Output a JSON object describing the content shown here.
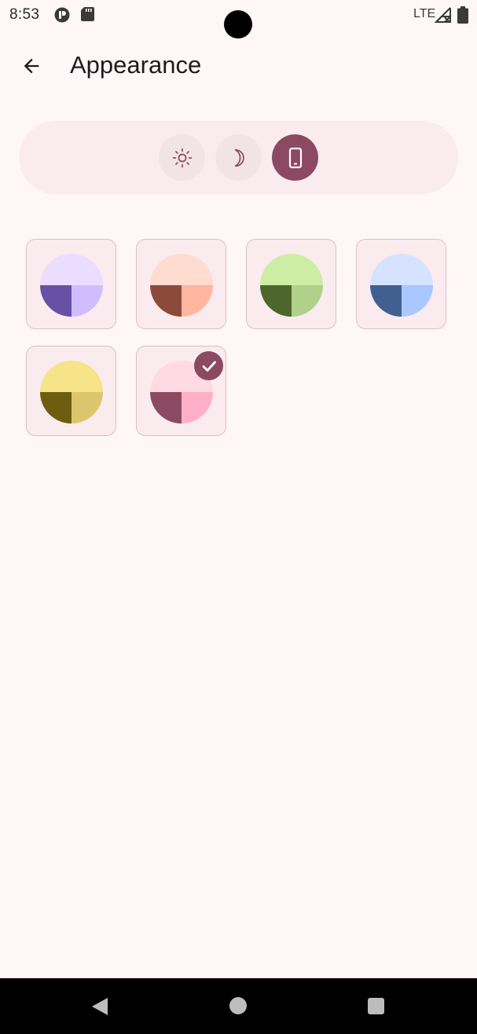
{
  "status_bar": {
    "time": "8:53",
    "network": "LTE",
    "icons": [
      "app-notification-icon",
      "sd-card-icon",
      "signal-no-data-icon",
      "battery-icon"
    ]
  },
  "app_bar": {
    "title": "Appearance",
    "back_icon": "arrow-back-icon"
  },
  "theme_mode": {
    "options": [
      {
        "name": "light",
        "icon": "sun-icon",
        "selected": false
      },
      {
        "name": "dark",
        "icon": "moon-icon",
        "selected": false
      },
      {
        "name": "system",
        "icon": "phone-icon",
        "selected": true
      }
    ],
    "selected_color": "#8B4A62"
  },
  "color_schemes": [
    {
      "name": "purple",
      "top": "#EADDFF",
      "bottom_left": "#6750A4",
      "bottom_right": "#D0BCFF",
      "selected": false
    },
    {
      "name": "orange",
      "top": "#FFDBD0",
      "bottom_left": "#8C4A3A",
      "bottom_right": "#FFB5A0",
      "selected": false
    },
    {
      "name": "green",
      "top": "#CDEDA4",
      "bottom_left": "#4C662B",
      "bottom_right": "#B1D18A",
      "selected": false
    },
    {
      "name": "blue",
      "top": "#D6E3FF",
      "bottom_left": "#415F91",
      "bottom_right": "#AAC7FF",
      "selected": false
    },
    {
      "name": "yellow",
      "top": "#F7E388",
      "bottom_left": "#6D5E0F",
      "bottom_right": "#DBC66E",
      "selected": false
    },
    {
      "name": "pink",
      "top": "#FFD9E3",
      "bottom_left": "#8B4A62",
      "bottom_right": "#FFB0C8",
      "selected": true
    }
  ],
  "nav_bar": {
    "icons": [
      "nav-back-icon",
      "nav-home-icon",
      "nav-recents-icon"
    ]
  }
}
